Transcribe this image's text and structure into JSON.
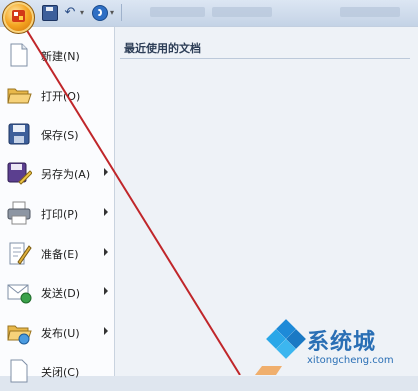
{
  "menu": {
    "recent_title": "最近使用的文档",
    "items": [
      {
        "label": "新建(N)",
        "icon": "new-document-icon",
        "submenu": false
      },
      {
        "label": "打开(O)",
        "icon": "open-folder-icon",
        "submenu": false
      },
      {
        "label": "保存(S)",
        "icon": "save-disk-icon",
        "submenu": false
      },
      {
        "label": "另存为(A)",
        "icon": "save-as-icon",
        "submenu": true
      },
      {
        "label": "打印(P)",
        "icon": "printer-icon",
        "submenu": true
      },
      {
        "label": "准备(E)",
        "icon": "prepare-document-icon",
        "submenu": true
      },
      {
        "label": "发送(D)",
        "icon": "send-envelope-icon",
        "submenu": true
      },
      {
        "label": "发布(U)",
        "icon": "publish-folder-icon",
        "submenu": true
      },
      {
        "label": "关闭(C)",
        "icon": "close-document-icon",
        "submenu": false
      }
    ]
  },
  "watermark": {
    "name": "系统城",
    "url": "xitongcheng.com"
  },
  "colors": {
    "annotation_line": "#c0262a",
    "accent": "#2a6fb5"
  }
}
